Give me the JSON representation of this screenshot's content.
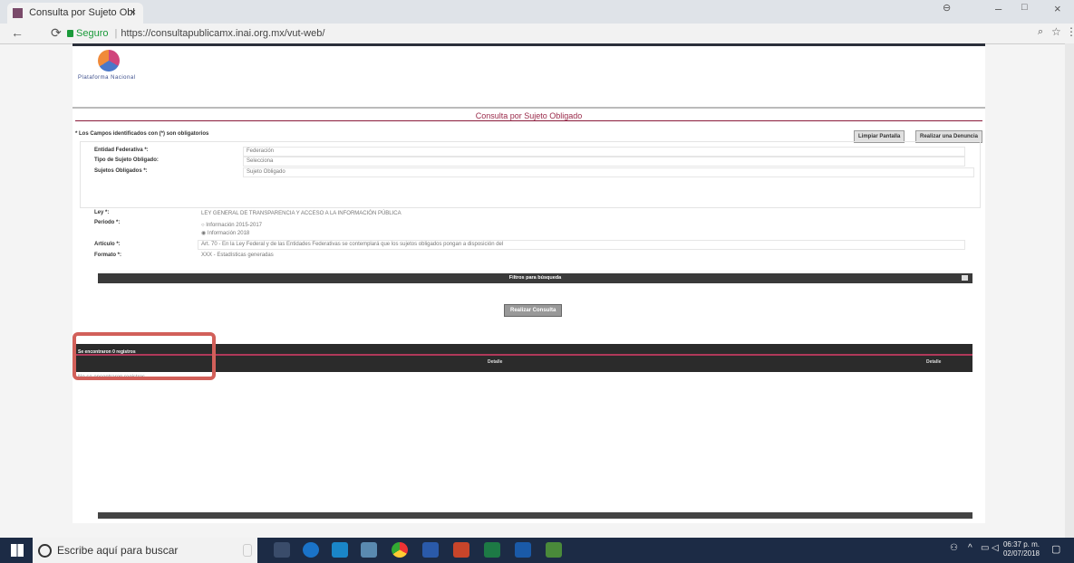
{
  "browser": {
    "tab_title": "Consulta por Sujeto Obl",
    "tab_close": "×",
    "secure_label": "Seguro",
    "url": "https://consultapublicamx.inai.org.mx/vut-web/",
    "window_controls": [
      "–",
      "□",
      "×"
    ]
  },
  "page": {
    "logo_text": "Plataforma Nacional",
    "title": "Consulta por Sujeto Obligado",
    "required_note": "* Los Campos identificados con (*) son obligatorios",
    "buttons": {
      "clear": "Limpiar Pantalla",
      "denuncia": "Realizar una Denuncia",
      "consult": "Realizar Consulta"
    },
    "form": {
      "entidad_label": "Entidad Federativa *:",
      "entidad_value": "Federación",
      "tipo_label": "Tipo de Sujeto Obligado:",
      "tipo_value": "Selecciona",
      "sujetos_label": "Sujetos Obligados *:",
      "sujetos_value": "Sujeto Obligado",
      "ley_label": "Ley *:",
      "ley_value": "LEY GENERAL DE TRANSPARENCIA Y ACCESO A LA INFORMACIÓN PÚBLICA",
      "periodo_label": "Periodo *:",
      "periodo_opt1": "Información 2015-2017",
      "periodo_opt2": "Información 2018",
      "articulo_label": "Artículo *:",
      "articulo_value": "Art. 70 - En la Ley Federal y de las Entidades Federativas se contemplará que los sujetos obligados pongan a disposición del",
      "formato_label": "Formato *:",
      "formato_value": "XXX - Estadísticas generadas"
    },
    "filter_bar": "Filtros para búsqueda",
    "results": {
      "found_text": "Se encontraron 0 registros",
      "detalle_col": "Detalle",
      "detalle_col2": "Detalle",
      "no_records": "No se encontraron registros"
    }
  },
  "taskbar": {
    "search_placeholder": "Escribe aquí para buscar",
    "time": "06:37 p. m.",
    "date": "02/07/2018"
  },
  "colors": {
    "accent": "#8a1a3a",
    "taskbar": "#1c2b45",
    "highlight_box": "#d2605a"
  }
}
